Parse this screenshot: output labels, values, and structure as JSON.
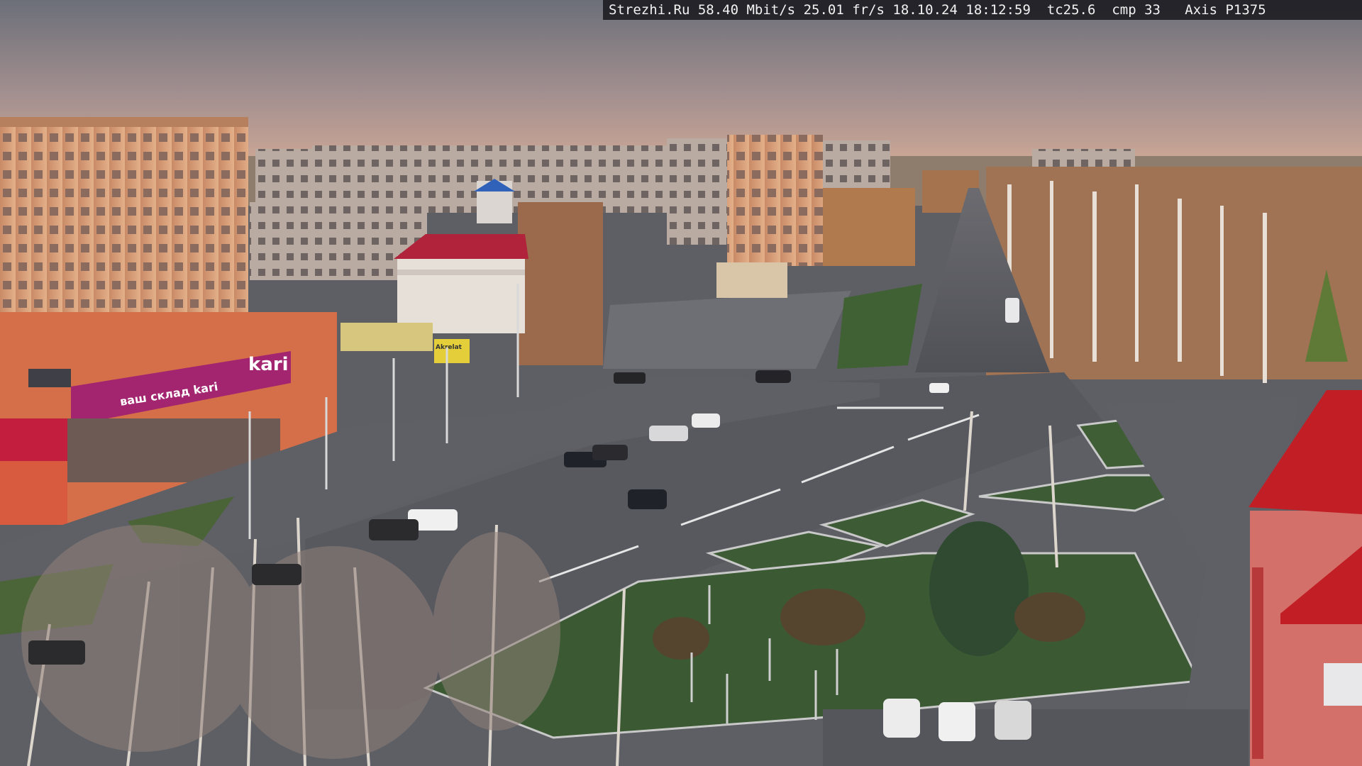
{
  "camera": {
    "overlay": {
      "site": "Strezhi.Ru",
      "bitrate": "58.40 Mbit/s",
      "fps": "25.01 fr/s",
      "date": "18.10.24",
      "time": "18:12:59",
      "tc": "tc25.6",
      "cmp": "cmp 33",
      "model": "Axis P1375"
    }
  },
  "signs": {
    "store_brand": "kari",
    "store_slogan": "ваш склад",
    "store_tagline": "ваш склад kari",
    "billboard": "Akrelat"
  },
  "colors": {
    "sky_top": "#74767f",
    "sky_bottom": "#c7a596",
    "lit_building": "#d79f78",
    "storefront_magenta": "#a3246f",
    "red_roof": "#c11f25",
    "grass": "#3d5b34",
    "asphalt": "#5a5b60"
  }
}
